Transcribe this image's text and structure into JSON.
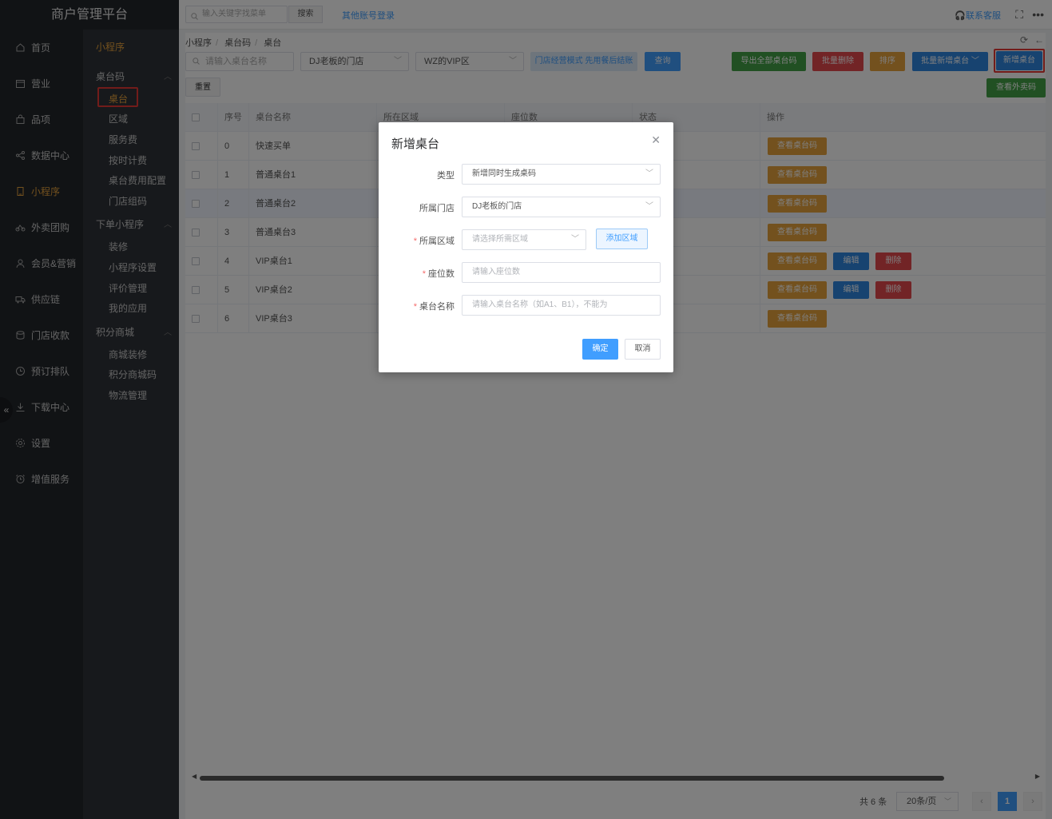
{
  "app": {
    "title": "商户管理平台"
  },
  "topbar": {
    "search_placeholder": "输入关键字找菜单",
    "search_button": "搜索",
    "other_login": "其他账号登录",
    "contact": "联系客服"
  },
  "nav1": [
    {
      "label": "首页",
      "icon": "home-icon"
    },
    {
      "label": "营业",
      "icon": "calendar-icon"
    },
    {
      "label": "品项",
      "icon": "bag-icon"
    },
    {
      "label": "数据中心",
      "icon": "share-icon"
    },
    {
      "label": "小程序",
      "icon": "tablet-icon"
    },
    {
      "label": "外卖团购",
      "icon": "bike-icon"
    },
    {
      "label": "会员&营销",
      "icon": "user-icon"
    },
    {
      "label": "供应链",
      "icon": "truck-icon"
    },
    {
      "label": "门店收款",
      "icon": "coins-icon"
    },
    {
      "label": "预订排队",
      "icon": "clock-icon"
    },
    {
      "label": "下载中心",
      "icon": "download-icon"
    },
    {
      "label": "设置",
      "icon": "gear-icon"
    },
    {
      "label": "增值服务",
      "icon": "alarm-icon"
    }
  ],
  "nav2": {
    "title": "小程序",
    "groups": [
      {
        "label": "桌台码",
        "items": [
          "桌台",
          "区域",
          "服务费",
          "按时计费",
          "桌台费用配置",
          "门店组码"
        ]
      },
      {
        "label": "下单小程序",
        "items": [
          "装修",
          "小程序设置",
          "评价管理",
          "我的应用"
        ]
      },
      {
        "label": "积分商城",
        "items": [
          "商城装修",
          "积分商城码",
          "物流管理"
        ]
      }
    ]
  },
  "breadcrumb": [
    "小程序",
    "桌台码",
    "桌台"
  ],
  "filters": {
    "name_placeholder": "请输入桌台名称",
    "store": "DJ老板的门店",
    "area": "WZ的VIP区",
    "mode_tag": "门店经营模式 先用餐后结账",
    "query": "查询",
    "reset": "重置"
  },
  "actions": {
    "export": "导出全部桌台码",
    "batch_delete": "批量删除",
    "sort": "排序",
    "batch_add": "批量新增桌台",
    "add": "新增桌台",
    "view_takeout": "查看外卖码"
  },
  "table": {
    "headers": [
      "序号",
      "桌台名称",
      "所在区域",
      "座位数",
      "状态",
      "操作"
    ],
    "rows": [
      {
        "no": "0",
        "name": "快速买单",
        "ops": [
          "查看桌台码"
        ]
      },
      {
        "no": "1",
        "name": "普通桌台1",
        "ops": [
          "查看桌台码"
        ]
      },
      {
        "no": "2",
        "name": "普通桌台2",
        "ops": [
          "查看桌台码"
        ]
      },
      {
        "no": "3",
        "name": "普通桌台3",
        "ops": [
          "查看桌台码"
        ]
      },
      {
        "no": "4",
        "name": "VIP桌台1",
        "ops": [
          "查看桌台码",
          "编辑",
          "删除"
        ]
      },
      {
        "no": "5",
        "name": "VIP桌台2",
        "ops": [
          "查看桌台码",
          "编辑",
          "删除"
        ]
      },
      {
        "no": "6",
        "name": "VIP桌台3",
        "ops": [
          "查看桌台码"
        ]
      }
    ]
  },
  "pager": {
    "total": "共 6 条",
    "size": "20条/页",
    "current": "1"
  },
  "dialog": {
    "title": "新增桌台",
    "type_label": "类型",
    "type_value": "新增同时生成桌码",
    "store_label": "所属门店",
    "store_value": "DJ老板的门店",
    "area_label": "所属区域",
    "area_placeholder": "请选择所需区域",
    "add_area": "添加区域",
    "seats_label": "座位数",
    "seats_placeholder": "请输入座位数",
    "name_label": "桌台名称",
    "name_placeholder": "请输入桌台名称（如A1、B1），不能为",
    "ok": "确定",
    "cancel": "取消"
  },
  "colors": {
    "accent": "#409eff",
    "active": "#e6a23c",
    "danger": "#e5484d",
    "success": "#43a047"
  }
}
